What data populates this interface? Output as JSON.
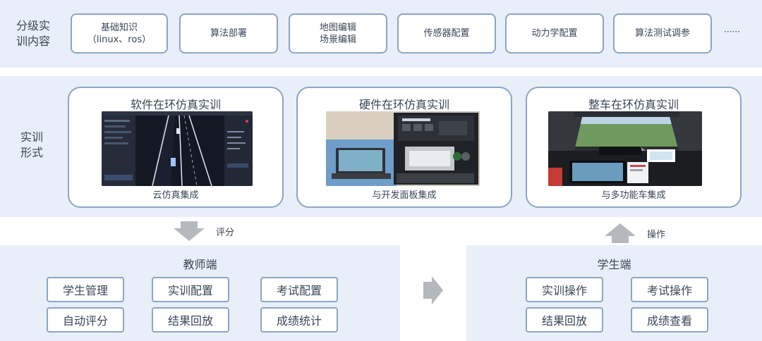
{
  "levels": {
    "label": "分级实\n训内容",
    "items": [
      "基础知识\n（linux、ros）",
      "算法部署",
      "地图编辑\n场景编辑",
      "传感器配置",
      "动力学配置",
      "算法测试调参"
    ],
    "more": "······"
  },
  "forms": {
    "label": "实训\n形式",
    "cards": [
      {
        "title": "软件在环仿真实训",
        "caption": "云仿真集成"
      },
      {
        "title": "硬件在环仿真实训",
        "caption": "与开发面板集成"
      },
      {
        "title": "整车在环仿真实训",
        "caption": "与多功能车集成"
      }
    ]
  },
  "flow": {
    "down_label": "评分",
    "up_label": "操作"
  },
  "teacher": {
    "title": "教师端",
    "buttons": [
      "学生管理",
      "实训配置",
      "考试配置",
      "自动评分",
      "结果回放",
      "成绩统计"
    ]
  },
  "student": {
    "title": "学生端",
    "buttons": [
      "实训操作",
      "考试操作",
      "结果回放",
      "成绩查看"
    ]
  },
  "colors": {
    "band": "#e8eff8",
    "border": "#8ea5c3",
    "arrow": "#b5b8bd"
  }
}
